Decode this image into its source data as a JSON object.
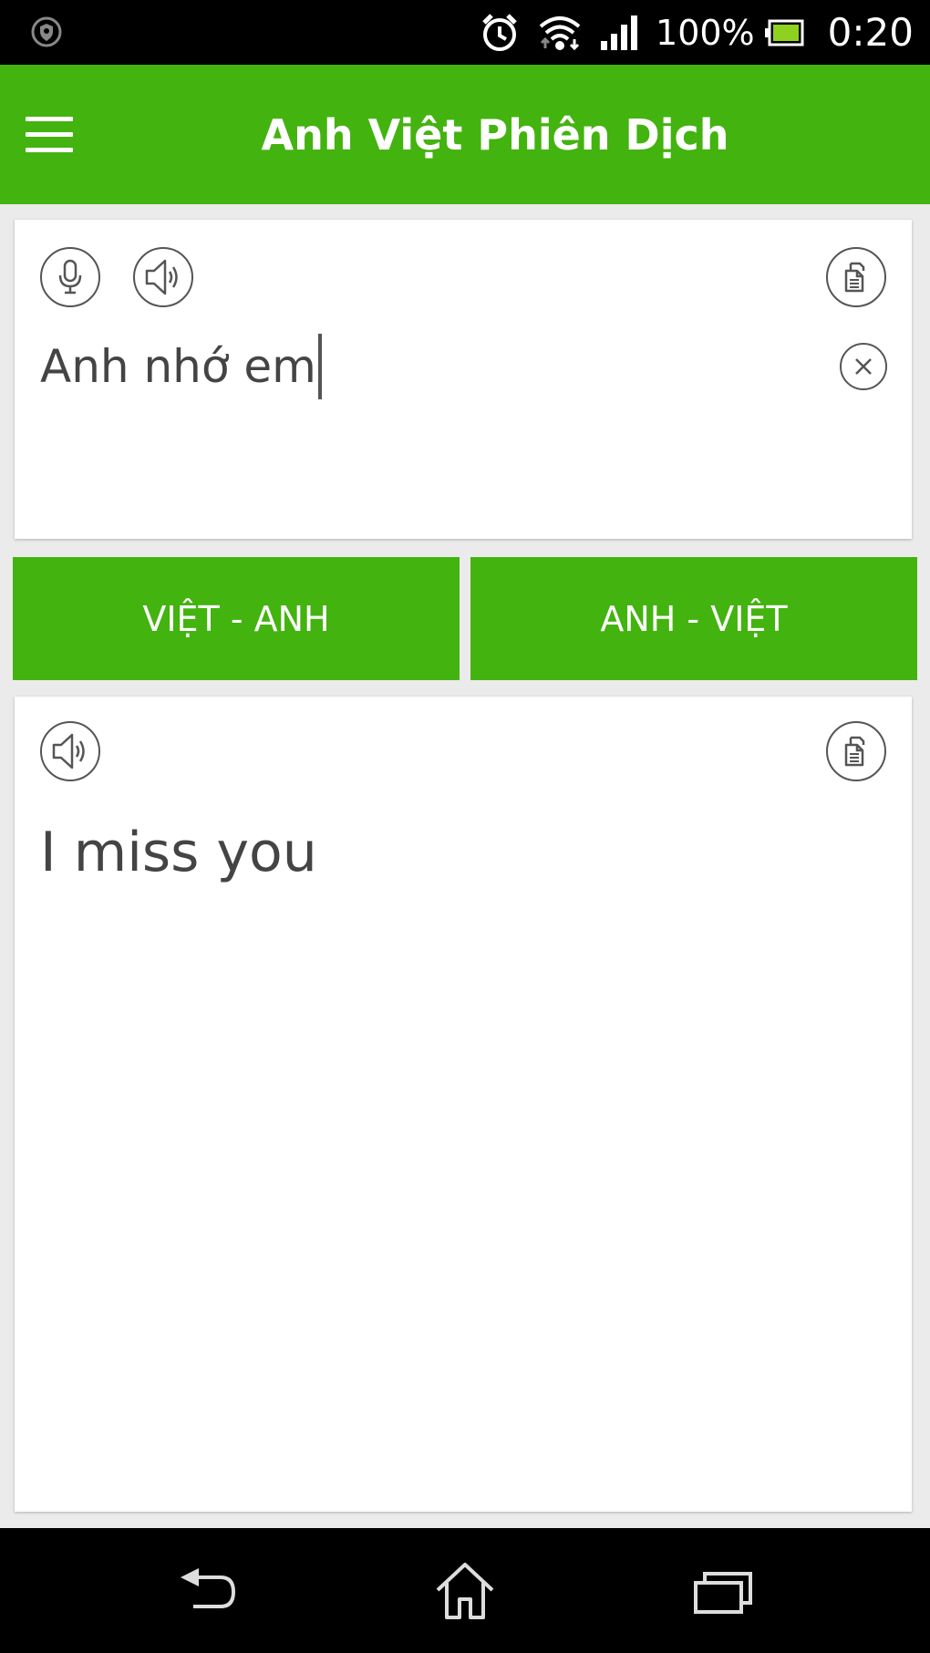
{
  "status_bar": {
    "battery_text": "100%",
    "time": "0:20",
    "icons": [
      "security-icon",
      "alarm-icon",
      "wifi-icon",
      "signal-icon",
      "battery-icon"
    ]
  },
  "app_bar": {
    "title": "Anh Việt Phiên Dịch",
    "color": "#43b30f",
    "menu_icon": "menu-icon"
  },
  "input_card": {
    "text": "Anh nhớ em",
    "icons": [
      "microphone-icon",
      "speaker-icon",
      "copy-icon",
      "clear-icon"
    ]
  },
  "direction_buttons": {
    "viet_anh": "VIỆT - ANH",
    "anh_viet": "ANH - VIỆT"
  },
  "output_card": {
    "text": "I miss you",
    "icons": [
      "speaker-icon",
      "copy-icon"
    ]
  },
  "nav_bar": {
    "icons": [
      "back-icon",
      "home-icon",
      "recent-apps-icon"
    ]
  }
}
